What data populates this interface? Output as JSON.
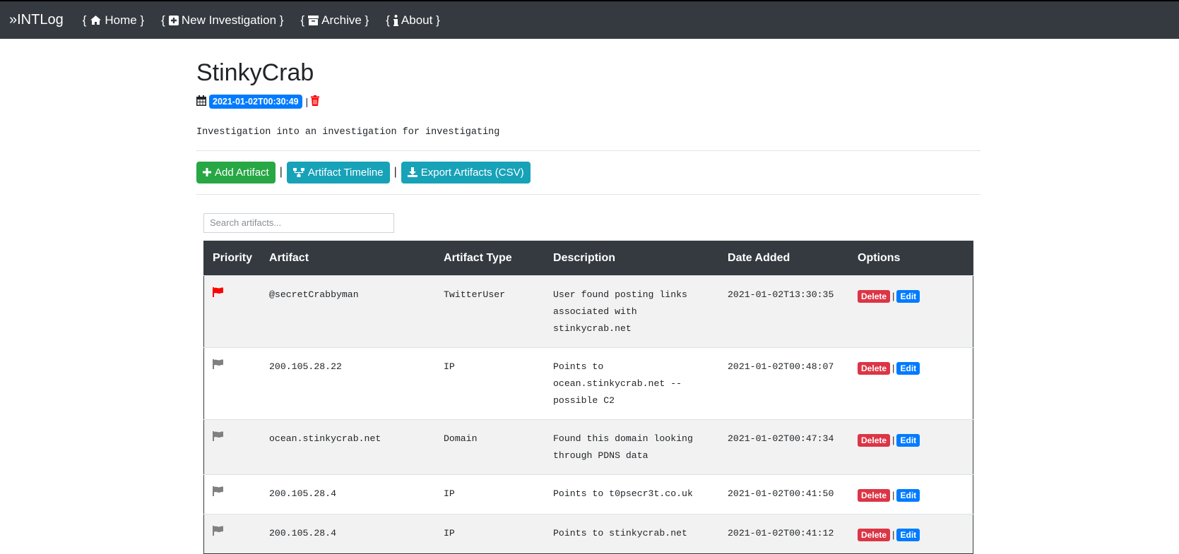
{
  "nav": {
    "brand": "»INTLog",
    "items": [
      {
        "label": "Home",
        "icon": "home-icon"
      },
      {
        "label": "New Investigation",
        "icon": "plus-square-icon"
      },
      {
        "label": "Archive",
        "icon": "archive-icon"
      },
      {
        "label": "About",
        "icon": "info-icon"
      }
    ]
  },
  "investigation": {
    "title": "StinkyCrab",
    "date": "2021-01-02T00:30:49",
    "description": "Investigation into an investigation for investigating"
  },
  "actions": {
    "add_artifact": "Add Artifact",
    "timeline": "Artifact Timeline",
    "export": "Export Artifacts (CSV)"
  },
  "search": {
    "placeholder": "Search artifacts..."
  },
  "table": {
    "headers": [
      "Priority",
      "Artifact",
      "Artifact Type",
      "Description",
      "Date Added",
      "Options"
    ],
    "rows": [
      {
        "priority": "high",
        "artifact": "@secretCrabbyman",
        "type": "TwitterUser",
        "description": "User found posting links associated with stinkycrab.net",
        "date": "2021-01-02T13:30:35"
      },
      {
        "priority": "normal",
        "artifact": "200.105.28.22",
        "type": "IP",
        "description": "Points to ocean.stinkycrab.net -- possible C2",
        "date": "2021-01-02T00:48:07"
      },
      {
        "priority": "normal",
        "artifact": "ocean.stinkycrab.net",
        "type": "Domain",
        "description": "Found this domain looking through PDNS data",
        "date": "2021-01-02T00:47:34"
      },
      {
        "priority": "normal",
        "artifact": "200.105.28.4",
        "type": "IP",
        "description": "Points to t0psecr3t.co.uk",
        "date": "2021-01-02T00:41:50"
      },
      {
        "priority": "normal",
        "artifact": "200.105.28.4",
        "type": "IP",
        "description": "Points to stinkycrab.net",
        "date": "2021-01-02T00:41:12"
      }
    ],
    "delete_label": "Delete",
    "edit_label": "Edit"
  },
  "colors": {
    "navbar": "#343a40",
    "flag_high": "#ff0000",
    "flag_normal": "#808080",
    "badge_primary": "#007bff",
    "danger": "#dc3545",
    "success": "#28a745",
    "info": "#17a2b8"
  }
}
